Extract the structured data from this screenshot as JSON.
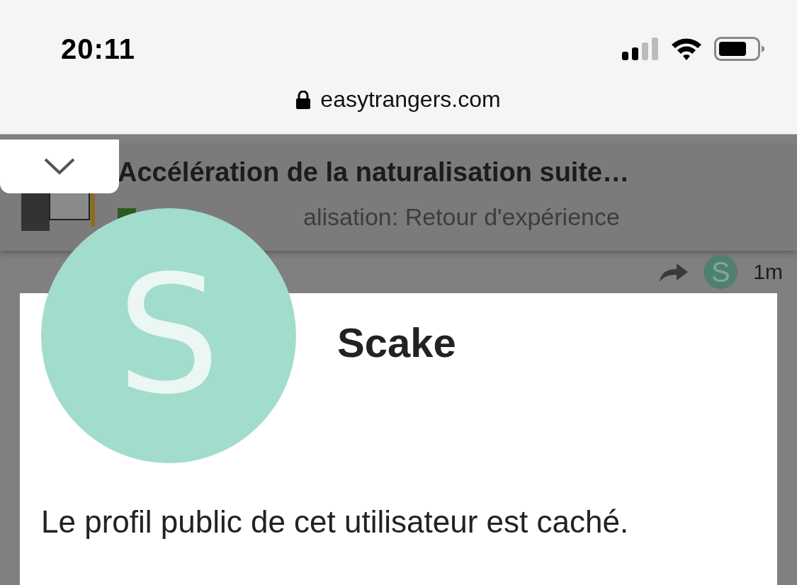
{
  "status_bar": {
    "time": "20:11",
    "url": "easytrangers.com"
  },
  "topic": {
    "title": "Accélération de la naturalisation suite…",
    "category": "alisation: Retour d'expérience"
  },
  "post": {
    "reply_avatar_letter": "S",
    "time": "1m"
  },
  "profile": {
    "avatar_letter": "S",
    "name": "Scake",
    "message": "Le profil public de cet utilisateur est caché."
  }
}
